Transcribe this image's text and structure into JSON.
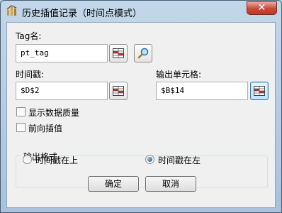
{
  "window": {
    "title": "历史插值记录（时间点模式）",
    "close_glyph": "✕"
  },
  "form": {
    "tag_label": "Tag名:",
    "tag_value": "pt_tag",
    "time_label": "时间戳:",
    "time_value": "$D$2",
    "output_label": "输出单元格:",
    "output_value": "$B$14",
    "show_quality_label": "显示数据质量",
    "show_quality_checked": false,
    "forward_interp_label": "前向插值",
    "forward_interp_checked": false
  },
  "output_format": {
    "title": "输出格式",
    "options": [
      {
        "label": "时间戳在上",
        "selected": false
      },
      {
        "label": "时间戳在左",
        "selected": true
      }
    ]
  },
  "buttons": {
    "ok": "确定",
    "cancel": "取消"
  },
  "icons": {
    "app": "app-icon",
    "range_select": "range-select-icon",
    "search": "search-icon"
  }
}
